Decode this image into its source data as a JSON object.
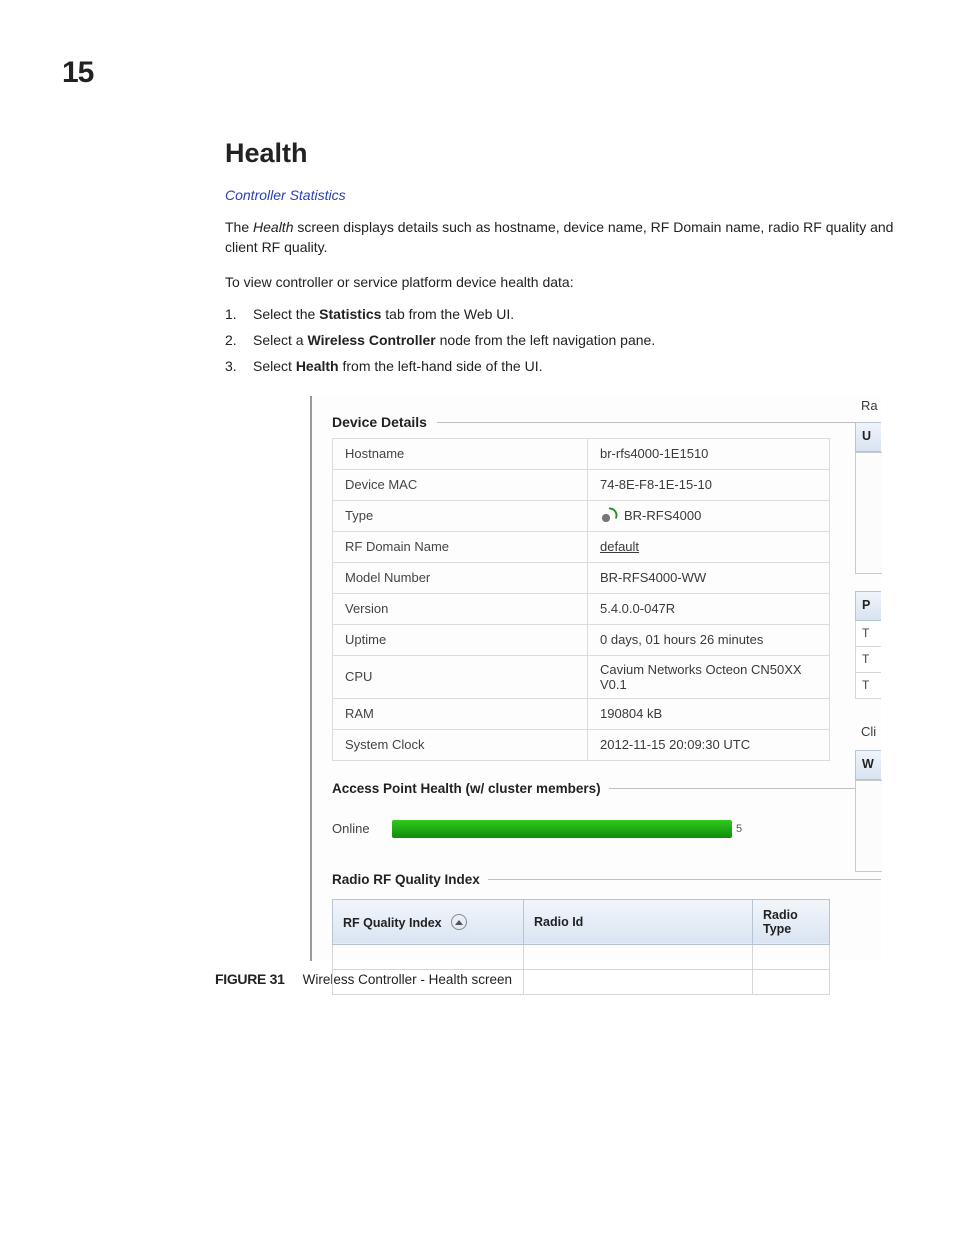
{
  "page_number": "15",
  "heading": "Health",
  "breadcrumb": "Controller Statistics",
  "para1_a": "The ",
  "para1_health": "Health",
  "para1_b": " screen displays details such as hostname, device name, RF Domain name, radio RF quality and client RF quality.",
  "para2": "To view controller or service platform device health data:",
  "steps": [
    {
      "n": "1.",
      "pre": "Select the ",
      "b": "Statistics",
      "post": " tab from the Web UI."
    },
    {
      "n": "2.",
      "pre": "Select a ",
      "b": "Wireless Controller",
      "post": " node from the left navigation pane."
    },
    {
      "n": "3.",
      "pre": "Select ",
      "b": "Health",
      "post": " from the left-hand side of the UI."
    }
  ],
  "screenshot": {
    "device_details_title": "Device Details",
    "rows": [
      {
        "label": "Hostname",
        "value": "br-rfs4000-1E1510"
      },
      {
        "label": "Device MAC",
        "value": "74-8E-F8-1E-15-10"
      },
      {
        "label": "Type",
        "value": "BR-RFS4000",
        "icon": "ap"
      },
      {
        "label": "RF Domain Name",
        "value": "default",
        "underline": true
      },
      {
        "label": "Model Number",
        "value": "BR-RFS4000-WW"
      },
      {
        "label": "Version",
        "value": "5.4.0.0-047R"
      },
      {
        "label": "Uptime",
        "value": "0 days, 01 hours 26 minutes"
      },
      {
        "label": "CPU",
        "value": "Cavium Networks Octeon CN50XX V0.1"
      },
      {
        "label": "RAM",
        "value": "190804 kB"
      },
      {
        "label": "System Clock",
        "value": "2012-11-15 20:09:30 UTC"
      }
    ],
    "aph_title": "Access Point Health (w/ cluster members)",
    "online_label": "Online",
    "online_value": "5",
    "rfq_title": "Radio RF Quality Index",
    "rfq_cols": [
      "RF Quality Index",
      "Radio Id",
      "Radio Type"
    ],
    "right_cut": {
      "lbl_ra": "Ra",
      "hdr_u": "U",
      "hdr_p": "P",
      "cells_t": "T",
      "lbl_cli": "Cli",
      "hdr_w": "W"
    }
  },
  "figure_label": "FIGURE 31",
  "figure_text": "Wireless Controller - Health screen"
}
